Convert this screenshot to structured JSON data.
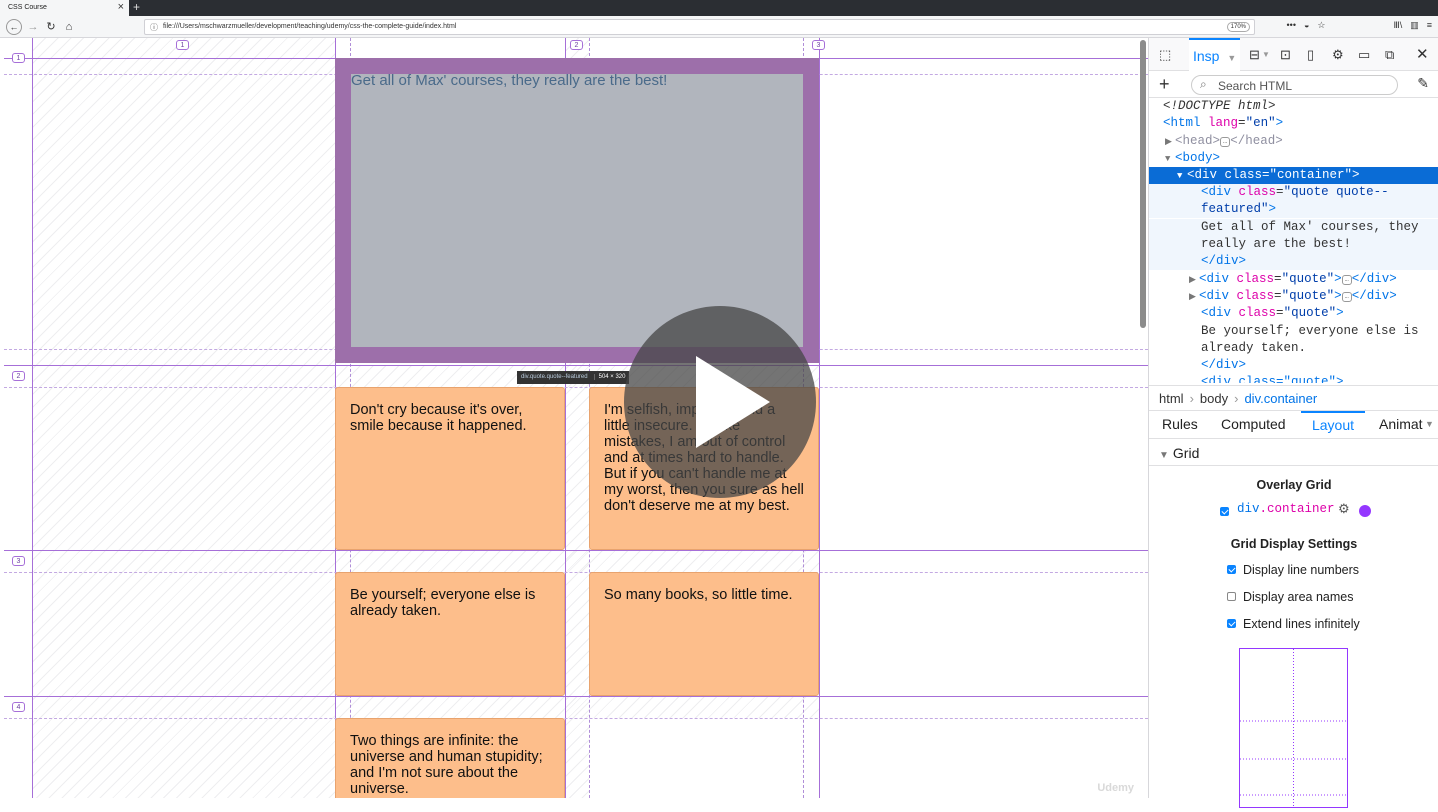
{
  "browser": {
    "tab_title": "CSS Course",
    "tab_close": "×",
    "new_tab": "+",
    "url": "file:///Users/mschwarzmueller/development/teaching/udemy/css-the-complete-guide/index.html",
    "zoom": "170%",
    "nav": {
      "back": "←",
      "forward": "→",
      "reload": "↻",
      "home": "⌂"
    },
    "toolbar_icons": [
      "more-icon",
      "pocket-icon",
      "star-icon",
      "library-icon",
      "sidebar-icon",
      "menu-icon"
    ],
    "toolbar_glyphs": {
      "more": "•••",
      "pocket": "◒",
      "star": "☆",
      "library": "Ⅲ\\",
      "sidebar": "▥",
      "menu": "≡"
    }
  },
  "page": {
    "grid_line_numbers": {
      "col1": "1",
      "col2": "2",
      "col3": "3",
      "row1": "1",
      "row2": "2",
      "row3": "3",
      "row4": "4"
    },
    "featured_quote": "Get all of Max' courses, they really are the best!",
    "quotes": [
      "Don't cry because it's over, smile because it happened.",
      "I'm selfish, impatient and a little insecure. I make mistakes, I am out of control and at times hard to handle. But if you can't handle me at my worst, then you sure as hell don't deserve me at my best.",
      "Be yourself; everyone else is already taken.",
      "So many books, so little time.",
      "Two things are infinite: the universe and human stupidity; and I'm not sure about the universe."
    ],
    "hover_label": {
      "selector": "div.quote.quote--featured",
      "size": "504 × 320"
    },
    "watermark": "Udemy"
  },
  "devtools": {
    "active_tool": "Insp",
    "search_placeholder": "Search HTML",
    "markup": {
      "doctype": "<!DOCTYPE html>",
      "html_open": "<html",
      "html_attr": "lang",
      "html_val": "\"en\"",
      "html_close": ">",
      "head": "<head>",
      "head_close": "</head>",
      "body": "<body>",
      "container_line": "<div class=\"container\">",
      "featured_open_1": "<div",
      "featured_attr": "class",
      "featured_val_1": "\"quote quote--",
      "featured_val_2": "featured\"",
      "featured_text_1": "Get all of Max' courses, they",
      "featured_text_2": "really are the best!",
      "div_close": "</div>",
      "quote_open": "<div",
      "quote_attr": "class",
      "quote_val": "\"quote\"",
      "quote_text_1": "Be yourself; everyone else is",
      "quote_text_2": "already taken.",
      "next_partial": "<div class=\"quote\">"
    },
    "breadcrumbs": [
      "html",
      "body",
      "div.container"
    ],
    "side_tabs": [
      "Rules",
      "Computed",
      "Layout",
      "Animat"
    ],
    "section": "Grid",
    "overlay_heading": "Overlay Grid",
    "container_tag": "div",
    "container_class": ".container",
    "overlay_color": "#9437ff",
    "settings_heading": "Grid Display Settings",
    "options": [
      {
        "label": "Display line numbers",
        "checked": true
      },
      {
        "label": "Display area names",
        "checked": false
      },
      {
        "label": "Extend lines infinitely",
        "checked": true
      }
    ]
  },
  "colors": {
    "quote_bg": "#fdbe8b",
    "featured_bg": "#9d6faa",
    "grid_line": "#a66fd8",
    "accent": "#0a84ff"
  }
}
